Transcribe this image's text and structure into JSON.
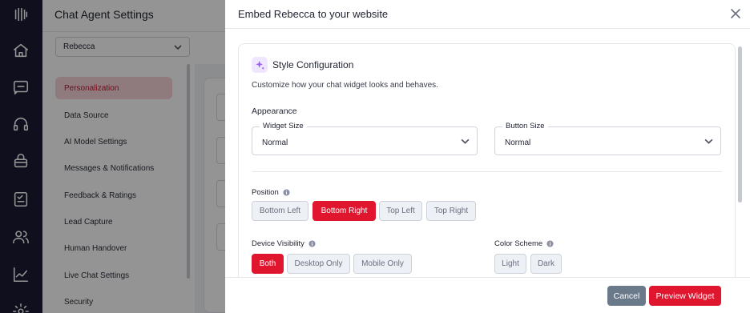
{
  "nav_rail": {
    "icons": [
      "logo-icon",
      "home-icon",
      "chat-icon",
      "headset-icon",
      "bag-icon",
      "tasks-icon",
      "users-icon",
      "chart-icon",
      "settings-icon"
    ]
  },
  "settings_page": {
    "title": "Chat Agent Settings",
    "agent_select": {
      "value": "Rebecca"
    },
    "menu": [
      {
        "label": "Personalization",
        "active": true
      },
      {
        "label": "Data Source"
      },
      {
        "label": "AI Model Settings"
      },
      {
        "label": "Messages & Notifications"
      },
      {
        "label": "Feedback & Ratings"
      },
      {
        "label": "Lead Capture"
      },
      {
        "label": "Human Handover"
      },
      {
        "label": "Live Chat Settings"
      },
      {
        "label": "Security"
      }
    ]
  },
  "modal": {
    "title": "Embed Rebecca to your website",
    "style_config": {
      "title": "Style Configuration",
      "subtitle": "Customize how your chat widget looks and behaves.",
      "appearance_label": "Appearance",
      "widget_size": {
        "label": "Widget Size",
        "value": "Normal"
      },
      "button_size": {
        "label": "Button Size",
        "value": "Normal"
      },
      "position": {
        "label": "Position",
        "options": [
          "Bottom Left",
          "Bottom Right",
          "Top Left",
          "Top Right"
        ],
        "selected": "Bottom Right"
      },
      "device_visibility": {
        "label": "Device Visibility",
        "options": [
          "Both",
          "Desktop Only",
          "Mobile Only"
        ],
        "selected": "Both"
      },
      "color_scheme": {
        "label": "Color Scheme",
        "options": [
          "Light",
          "Dark"
        ],
        "selected": null
      }
    },
    "footer": {
      "cancel_label": "Cancel",
      "preview_label": "Preview Widget"
    }
  },
  "colors": {
    "accent": "#e0162f",
    "rail_bg": "#1b1a33",
    "active_menu_bg": "#f7d4d9",
    "cancel_bg": "#6b7a8b"
  }
}
